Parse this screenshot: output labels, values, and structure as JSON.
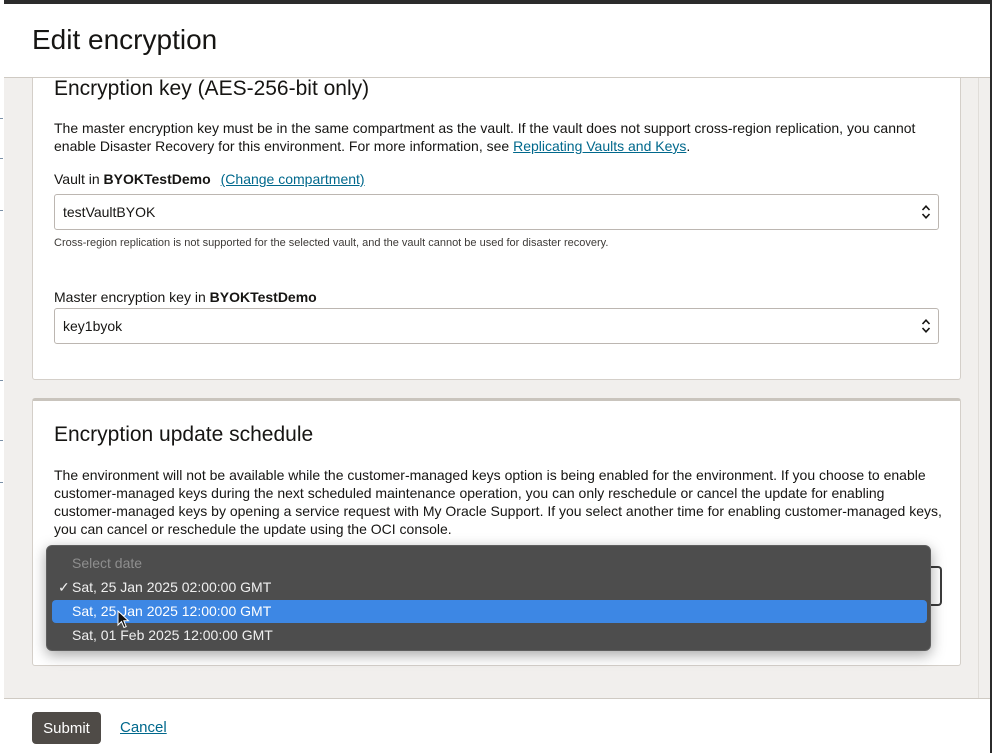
{
  "dialog": {
    "title": "Edit encryption"
  },
  "encryption_key": {
    "heading": "Encryption key (AES-256-bit only)",
    "description_text": "The master encryption key must be in the same compartment as the vault. If the vault does not support cross-region replication, you cannot enable Disaster Recovery for this environment. For more information, see ",
    "description_link": "Replicating Vaults and Keys",
    "description_end": ".",
    "vault_label_prefix": "Vault in ",
    "vault_compartment": "BYOKTestDemo",
    "change_compartment": "(Change compartment)",
    "vault_value": "testVaultBYOK",
    "vault_hint": "Cross-region replication is not supported for the selected vault, and the vault cannot be used for disaster recovery.",
    "key_label_prefix": "Master encryption key in ",
    "key_compartment": "BYOKTestDemo",
    "key_value": "key1byok"
  },
  "schedule": {
    "heading": "Encryption update schedule",
    "description": "The environment will not be available while the customer-managed keys option is being enabled for the environment. If you choose to enable customer-managed keys during the next scheduled maintenance operation, you can only reschedule or cancel the update for enabling customer-managed keys by opening a service request with My Oracle Support. If you select another time for enabling customer-managed keys, you can cancel or reschedule the update using the OCI console.",
    "dropdown": {
      "placeholder": "Select date",
      "options": [
        {
          "label": "Sat, 25 Jan 2025 02:00:00 GMT",
          "checked": "✓"
        },
        {
          "label": "Sat, 25 Jan 2025 12:00:00 GMT"
        },
        {
          "label": "Sat, 01 Feb 2025 12:00:00 GMT"
        }
      ],
      "highlight_color": "#3d87e4"
    }
  },
  "footer": {
    "submit": "Submit",
    "cancel": "Cancel"
  },
  "colors": {
    "primary_button": "#4f4b47",
    "link": "#00688c",
    "panel_background": "#f1efed"
  }
}
